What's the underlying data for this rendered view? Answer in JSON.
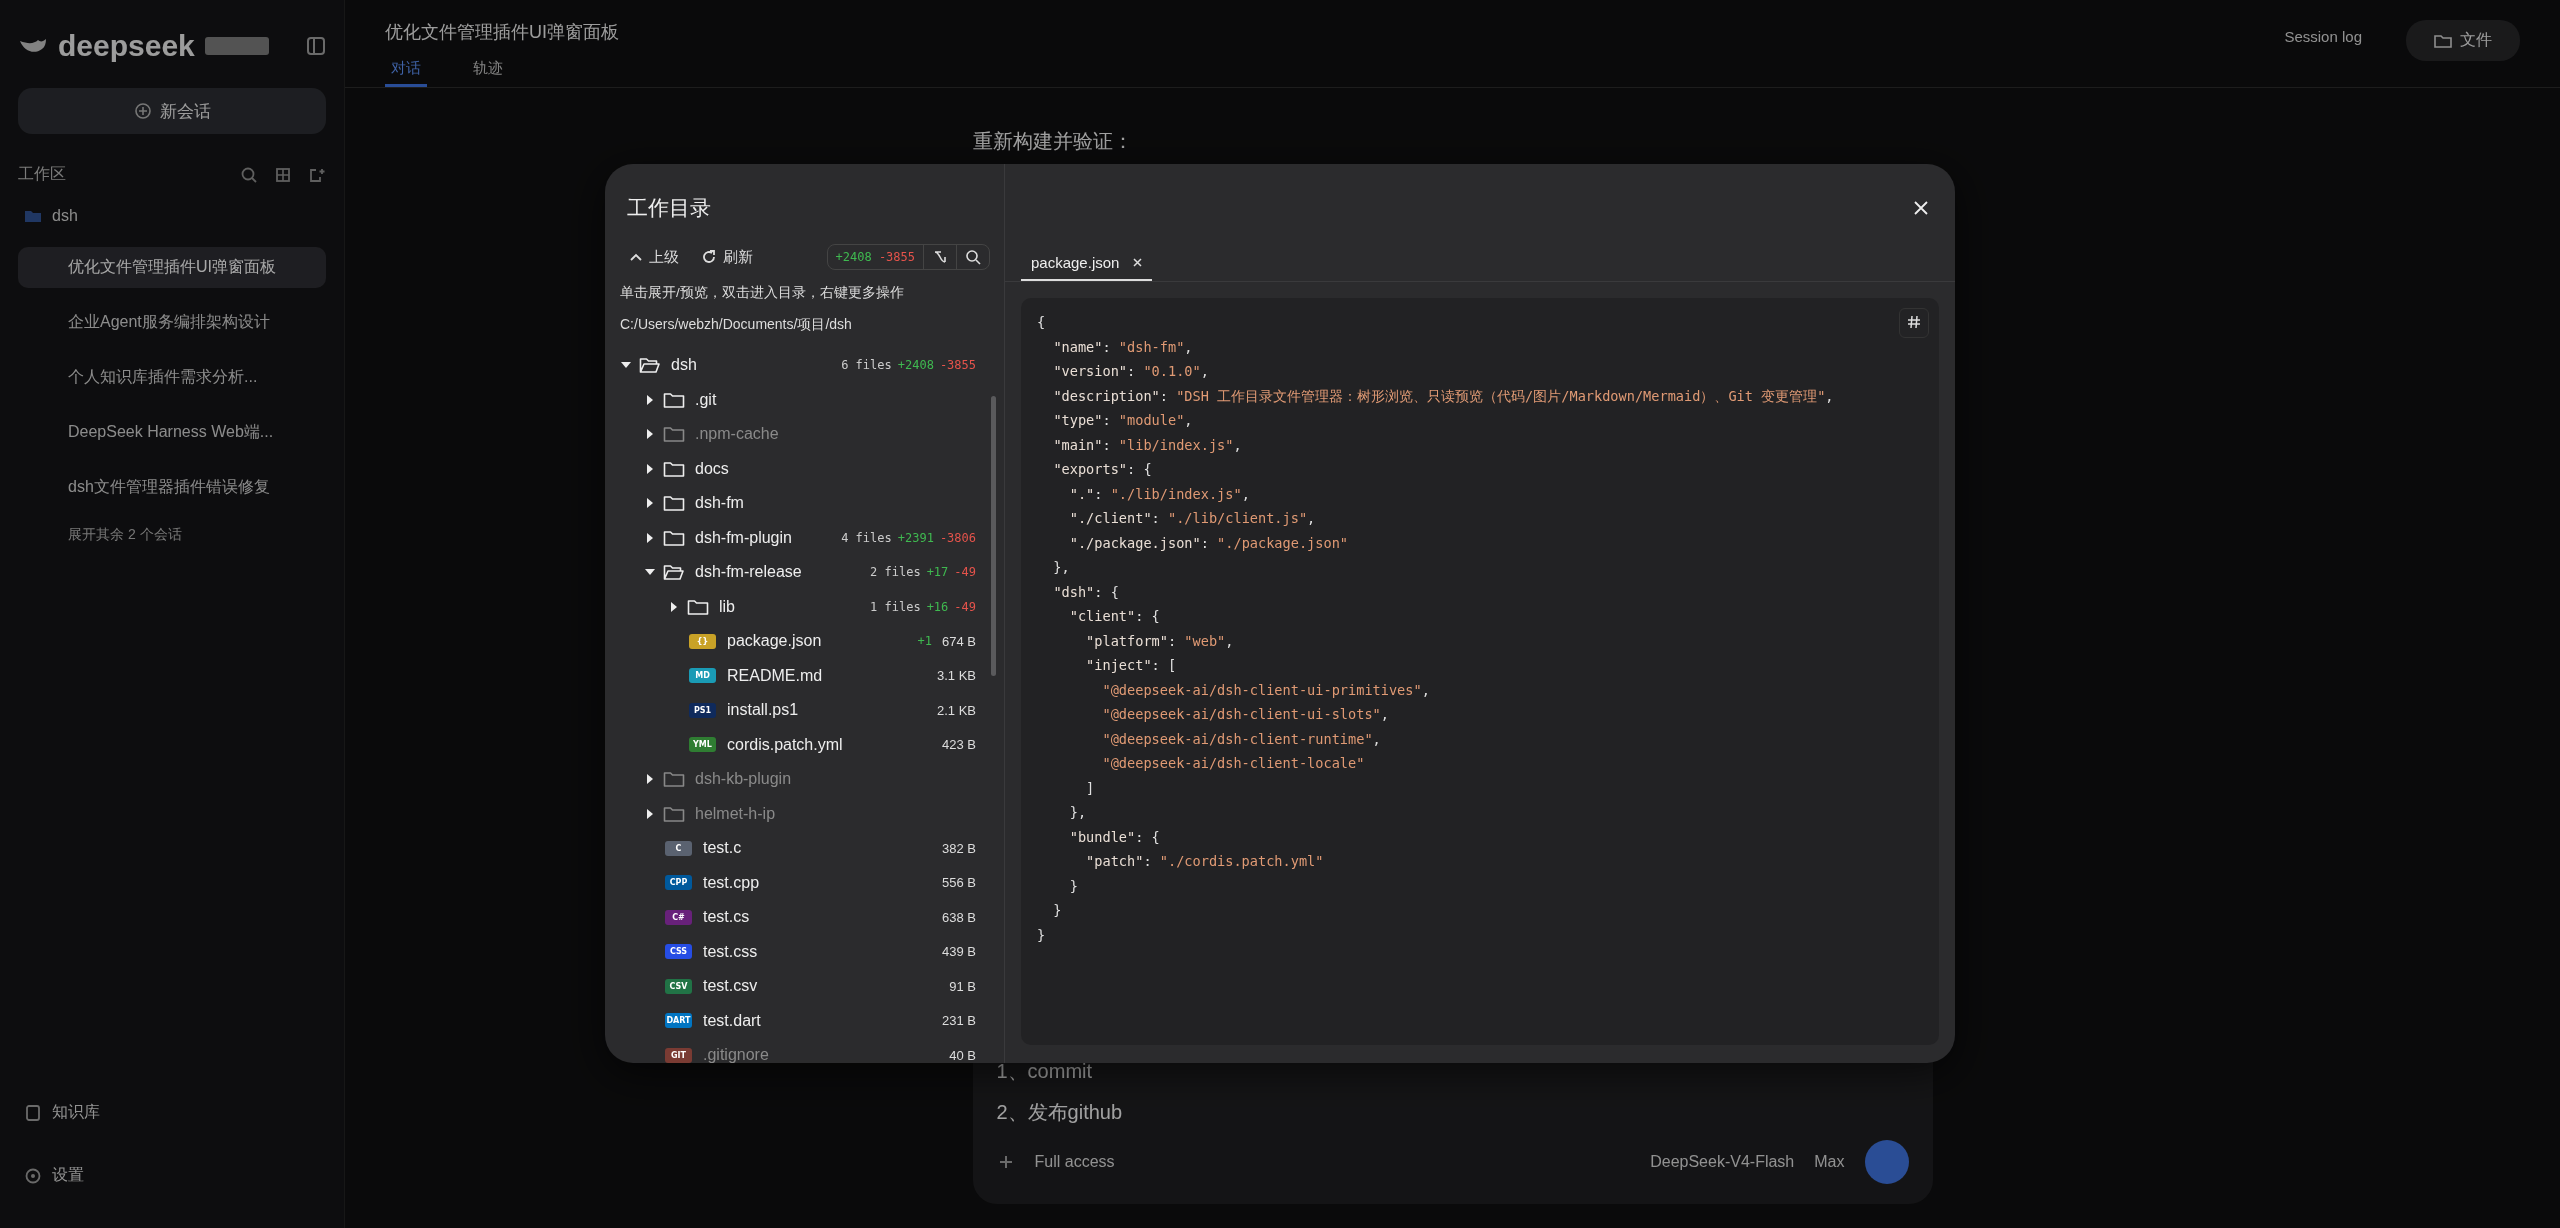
{
  "sidebar": {
    "logo": "deepseek",
    "new_chat": "新会话",
    "workspace_label": "工作区",
    "project": "dsh",
    "sessions": [
      {
        "title": "优化文件管理插件UI弹窗面板",
        "selected": true
      },
      {
        "title": "企业Agent服务编排架构设计",
        "selected": false
      },
      {
        "title": "个人知识库插件需求分析...",
        "selected": false
      },
      {
        "title": "DeepSeek Harness Web端...",
        "selected": false
      },
      {
        "title": "dsh文件管理器插件错误修复",
        "selected": false
      }
    ],
    "more": "展开其余 2 个会话",
    "footer": [
      {
        "label": "知识库"
      },
      {
        "label": "设置"
      }
    ]
  },
  "header": {
    "title": "优化文件管理插件UI弹窗面板",
    "tabs": [
      {
        "label": "对话",
        "selected": true
      },
      {
        "label": "轨迹",
        "selected": false
      }
    ],
    "session_log": "Session log",
    "files_button": "文件"
  },
  "chat": {
    "paragraph": "重新构建并验证：",
    "list": [
      "1、commit",
      "2、发布github"
    ],
    "access": "Full access",
    "model": "DeepSeek-V4-Flash",
    "effort": "Max"
  },
  "dialog": {
    "title": "工作目录",
    "toolbar": {
      "up": "上级",
      "refresh": "刷新",
      "added": "+2408",
      "removed": "-3855"
    },
    "hint": "单击展开/预览，双击进入目录，右键更多操作",
    "path": "C:/Users/webzh/Documents/项目/dsh",
    "tree": [
      {
        "kind": "folder",
        "name": "dsh",
        "expanded": true,
        "dimmed": false,
        "files": "6 files",
        "added": "+2408",
        "removed": "-3855",
        "children": [
          {
            "kind": "folder",
            "name": ".git",
            "expanded": false,
            "dimmed": false
          },
          {
            "kind": "folder",
            "name": ".npm-cache",
            "expanded": false,
            "dimmed": true
          },
          {
            "kind": "folder",
            "name": "docs",
            "expanded": false,
            "dimmed": false
          },
          {
            "kind": "folder",
            "name": "dsh-fm",
            "expanded": false,
            "dimmed": false
          },
          {
            "kind": "folder",
            "name": "dsh-fm-plugin",
            "expanded": false,
            "dimmed": false,
            "files": "4 files",
            "added": "+2391",
            "removed": "-3806"
          },
          {
            "kind": "folder",
            "name": "dsh-fm-release",
            "expanded": true,
            "dimmed": false,
            "files": "2 files",
            "added": "+17",
            "removed": "-49",
            "children": [
              {
                "kind": "folder",
                "name": "lib",
                "expanded": false,
                "dimmed": false,
                "files": "1 files",
                "added": "+16",
                "removed": "-49"
              },
              {
                "kind": "file",
                "name": "package.json",
                "badge": "{}",
                "color": "#c9a227",
                "added": "+1",
                "size": "674 B"
              },
              {
                "kind": "file",
                "name": "README.md",
                "badge": "MD",
                "color": "#1a9bb5",
                "size": "3.1 KB"
              },
              {
                "kind": "file",
                "name": "install.ps1",
                "badge": "PS1",
                "color": "#0f2a5c",
                "size": "2.1 KB"
              },
              {
                "kind": "file",
                "name": "cordis.patch.yml",
                "badge": "YML",
                "color": "#2f7d32",
                "size": "423 B"
              }
            ]
          },
          {
            "kind": "folder",
            "name": "dsh-kb-plugin",
            "expanded": false,
            "dimmed": true
          },
          {
            "kind": "folder",
            "name": "helmet-h-ip",
            "expanded": false,
            "dimmed": true
          },
          {
            "kind": "file",
            "name": "test.c",
            "badge": "C",
            "color": "#5a6270",
            "size": "382 B"
          },
          {
            "kind": "file",
            "name": "test.cpp",
            "badge": "CPP",
            "color": "#00599c",
            "size": "556 B"
          },
          {
            "kind": "file",
            "name": "test.cs",
            "badge": "C#",
            "color": "#68217a",
            "size": "638 B"
          },
          {
            "kind": "file",
            "name": "test.css",
            "badge": "CSS",
            "color": "#264de4",
            "size": "439 B"
          },
          {
            "kind": "file",
            "name": "test.csv",
            "badge": "CSV",
            "color": "#217346",
            "size": "91 B"
          },
          {
            "kind": "file",
            "name": "test.dart",
            "badge": "DART",
            "color": "#0175c2",
            "size": "231 B"
          },
          {
            "kind": "file",
            "name": ".gitignore",
            "badge": "GIT",
            "color": "#7a3b33",
            "size": "40 B",
            "dimmed": true
          }
        ]
      }
    ],
    "tabs": [
      {
        "label": "package.json",
        "selected": true
      }
    ],
    "code": [
      "{",
      "  \"name\": \"dsh-fm\",",
      "  \"version\": \"0.1.0\",",
      "  \"description\": \"DSH 工作目录文件管理器：树形浏览、只读预览（代码/图片/Markdown/Mermaid）、Git 变更管理\",",
      "  \"type\": \"module\",",
      "  \"main\": \"lib/index.js\",",
      "  \"exports\": {",
      "    \".\": \"./lib/index.js\",",
      "    \"./client\": \"./lib/client.js\",",
      "    \"./package.json\": \"./package.json\"",
      "  },",
      "  \"dsh\": {",
      "    \"client\": {",
      "      \"platform\": \"web\",",
      "      \"inject\": [",
      "        \"@deepseek-ai/dsh-client-ui-primitives\",",
      "        \"@deepseek-ai/dsh-client-ui-slots\",",
      "        \"@deepseek-ai/dsh-client-runtime\",",
      "        \"@deepseek-ai/dsh-client-locale\"",
      "      ]",
      "    },",
      "    \"bundle\": {",
      "      \"patch\": \"./cordis.patch.yml\"",
      "    }",
      "  }",
      "}"
    ]
  }
}
